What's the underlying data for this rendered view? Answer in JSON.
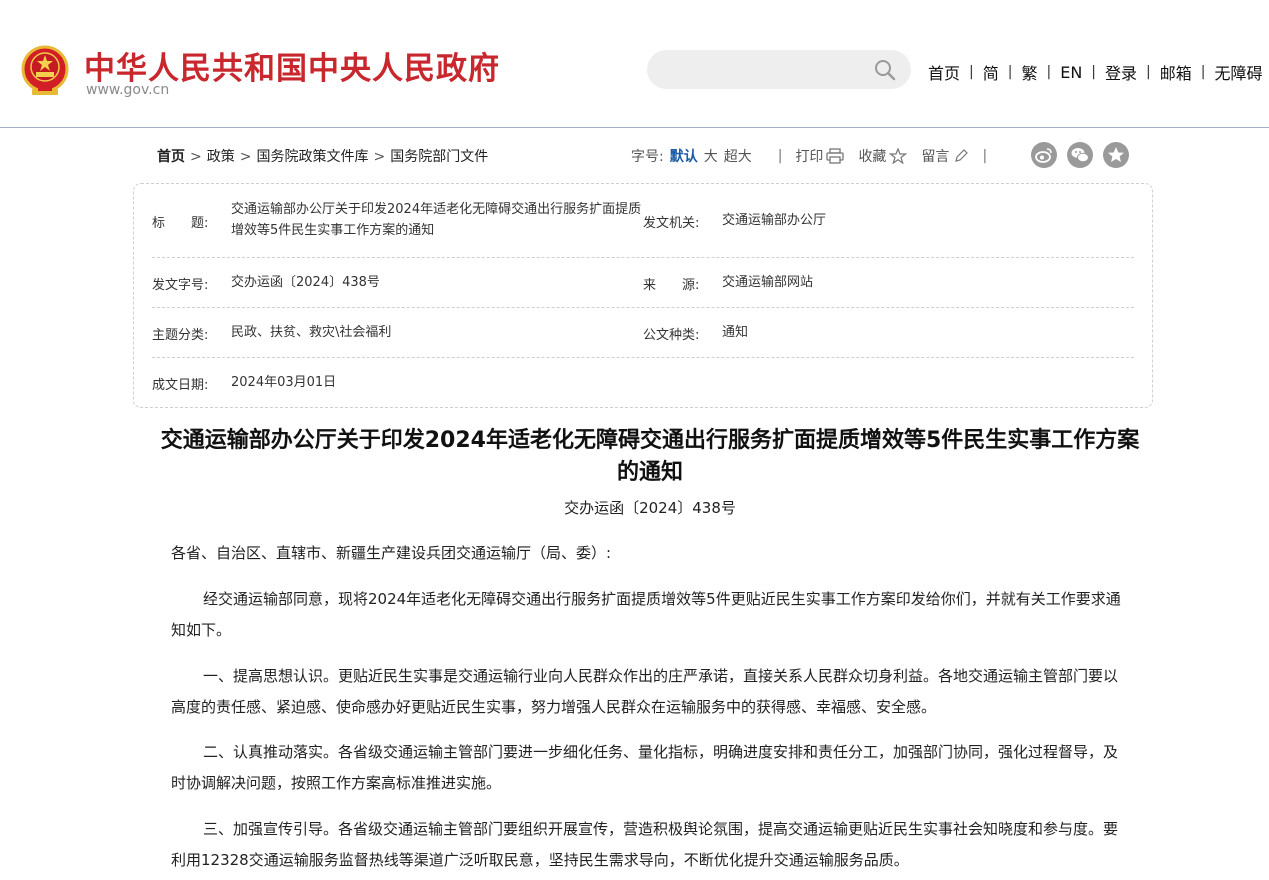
{
  "header": {
    "site_title": "中华人民共和国中央人民政府",
    "site_url": "www.gov.cn",
    "search": {
      "placeholder": ""
    },
    "nav": [
      "首页",
      "简",
      "繁",
      "EN",
      "登录",
      "邮箱",
      "无障碍"
    ],
    "accent_color": "#c9272e"
  },
  "breadcrumb": [
    "首页",
    "政策",
    "国务院政策文件库",
    "国务院部门文件"
  ],
  "toolbar": {
    "font_size_label": "字号:",
    "font_sizes": [
      "默认",
      "大",
      "超大"
    ],
    "print_label": "打印",
    "favorite_label": "收藏",
    "comment_label": "留言",
    "share_icons": [
      "weibo-icon",
      "wechat-icon",
      "favorite-star-icon"
    ]
  },
  "info": {
    "title_label": "标　　题:",
    "title_value": "交通运输部办公厅关于印发2024年适老化无障碍交通出行服务扩面提质增效等5件民生实事工作方案的通知",
    "issuer_label": "发文机关:",
    "issuer_value": "交通运输部办公厅",
    "doc_no_label": "发文字号:",
    "doc_no_value": "交办运函〔2024〕438号",
    "source_label": "来　　源:",
    "source_value": "交通运输部网站",
    "topic_label": "主题分类:",
    "topic_value": "民政、扶贫、救灾\\社会福利",
    "type_label": "公文种类:",
    "type_value": "通知",
    "date_label": "成文日期:",
    "date_value": "2024年03月01日"
  },
  "article": {
    "title": "交通运输部办公厅关于印发2024年适老化无障碍交通出行服务扩面提质增效等5件民生实事工作方案的通知",
    "doc_no": "交办运函〔2024〕438号",
    "salutation": "各省、自治区、直辖市、新疆生产建设兵团交通运输厅（局、委）:",
    "paragraphs": [
      "经交通运输部同意，现将2024年适老化无障碍交通出行服务扩面提质增效等5件更贴近民生实事工作方案印发给你们，并就有关工作要求通知如下。",
      "一、提高思想认识。更贴近民生实事是交通运输行业向人民群众作出的庄严承诺，直接关系人民群众切身利益。各地交通运输主管部门要以高度的责任感、紧迫感、使命感办好更贴近民生实事，努力增强人民群众在运输服务中的获得感、幸福感、安全感。",
      "二、认真推动落实。各省级交通运输主管部门要进一步细化任务、量化指标，明确进度安排和责任分工，加强部门协同，强化过程督导，及时协调解决问题，按照工作方案高标准推进实施。",
      "三、加强宣传引导。各省级交通运输主管部门要组织开展宣传，营造积极舆论氛围，提高交通运输更贴近民生实事社会知晓度和参与度。要利用12328交通运输服务监督热线等渠道广泛听取民意，坚持民生需求导向，不断优化提升交通运输服务品质。"
    ]
  }
}
